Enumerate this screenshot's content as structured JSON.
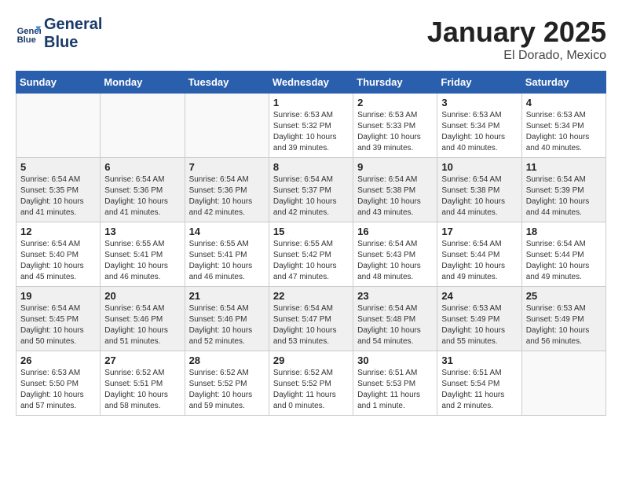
{
  "header": {
    "logo_line1": "General",
    "logo_line2": "Blue",
    "month": "January 2025",
    "location": "El Dorado, Mexico"
  },
  "days_of_week": [
    "Sunday",
    "Monday",
    "Tuesday",
    "Wednesday",
    "Thursday",
    "Friday",
    "Saturday"
  ],
  "weeks": [
    [
      {
        "num": "",
        "info": ""
      },
      {
        "num": "",
        "info": ""
      },
      {
        "num": "",
        "info": ""
      },
      {
        "num": "1",
        "info": "Sunrise: 6:53 AM\nSunset: 5:32 PM\nDaylight: 10 hours\nand 39 minutes."
      },
      {
        "num": "2",
        "info": "Sunrise: 6:53 AM\nSunset: 5:33 PM\nDaylight: 10 hours\nand 39 minutes."
      },
      {
        "num": "3",
        "info": "Sunrise: 6:53 AM\nSunset: 5:34 PM\nDaylight: 10 hours\nand 40 minutes."
      },
      {
        "num": "4",
        "info": "Sunrise: 6:53 AM\nSunset: 5:34 PM\nDaylight: 10 hours\nand 40 minutes."
      }
    ],
    [
      {
        "num": "5",
        "info": "Sunrise: 6:54 AM\nSunset: 5:35 PM\nDaylight: 10 hours\nand 41 minutes."
      },
      {
        "num": "6",
        "info": "Sunrise: 6:54 AM\nSunset: 5:36 PM\nDaylight: 10 hours\nand 41 minutes."
      },
      {
        "num": "7",
        "info": "Sunrise: 6:54 AM\nSunset: 5:36 PM\nDaylight: 10 hours\nand 42 minutes."
      },
      {
        "num": "8",
        "info": "Sunrise: 6:54 AM\nSunset: 5:37 PM\nDaylight: 10 hours\nand 42 minutes."
      },
      {
        "num": "9",
        "info": "Sunrise: 6:54 AM\nSunset: 5:38 PM\nDaylight: 10 hours\nand 43 minutes."
      },
      {
        "num": "10",
        "info": "Sunrise: 6:54 AM\nSunset: 5:38 PM\nDaylight: 10 hours\nand 44 minutes."
      },
      {
        "num": "11",
        "info": "Sunrise: 6:54 AM\nSunset: 5:39 PM\nDaylight: 10 hours\nand 44 minutes."
      }
    ],
    [
      {
        "num": "12",
        "info": "Sunrise: 6:54 AM\nSunset: 5:40 PM\nDaylight: 10 hours\nand 45 minutes."
      },
      {
        "num": "13",
        "info": "Sunrise: 6:55 AM\nSunset: 5:41 PM\nDaylight: 10 hours\nand 46 minutes."
      },
      {
        "num": "14",
        "info": "Sunrise: 6:55 AM\nSunset: 5:41 PM\nDaylight: 10 hours\nand 46 minutes."
      },
      {
        "num": "15",
        "info": "Sunrise: 6:55 AM\nSunset: 5:42 PM\nDaylight: 10 hours\nand 47 minutes."
      },
      {
        "num": "16",
        "info": "Sunrise: 6:54 AM\nSunset: 5:43 PM\nDaylight: 10 hours\nand 48 minutes."
      },
      {
        "num": "17",
        "info": "Sunrise: 6:54 AM\nSunset: 5:44 PM\nDaylight: 10 hours\nand 49 minutes."
      },
      {
        "num": "18",
        "info": "Sunrise: 6:54 AM\nSunset: 5:44 PM\nDaylight: 10 hours\nand 49 minutes."
      }
    ],
    [
      {
        "num": "19",
        "info": "Sunrise: 6:54 AM\nSunset: 5:45 PM\nDaylight: 10 hours\nand 50 minutes."
      },
      {
        "num": "20",
        "info": "Sunrise: 6:54 AM\nSunset: 5:46 PM\nDaylight: 10 hours\nand 51 minutes."
      },
      {
        "num": "21",
        "info": "Sunrise: 6:54 AM\nSunset: 5:46 PM\nDaylight: 10 hours\nand 52 minutes."
      },
      {
        "num": "22",
        "info": "Sunrise: 6:54 AM\nSunset: 5:47 PM\nDaylight: 10 hours\nand 53 minutes."
      },
      {
        "num": "23",
        "info": "Sunrise: 6:54 AM\nSunset: 5:48 PM\nDaylight: 10 hours\nand 54 minutes."
      },
      {
        "num": "24",
        "info": "Sunrise: 6:53 AM\nSunset: 5:49 PM\nDaylight: 10 hours\nand 55 minutes."
      },
      {
        "num": "25",
        "info": "Sunrise: 6:53 AM\nSunset: 5:49 PM\nDaylight: 10 hours\nand 56 minutes."
      }
    ],
    [
      {
        "num": "26",
        "info": "Sunrise: 6:53 AM\nSunset: 5:50 PM\nDaylight: 10 hours\nand 57 minutes."
      },
      {
        "num": "27",
        "info": "Sunrise: 6:52 AM\nSunset: 5:51 PM\nDaylight: 10 hours\nand 58 minutes."
      },
      {
        "num": "28",
        "info": "Sunrise: 6:52 AM\nSunset: 5:52 PM\nDaylight: 10 hours\nand 59 minutes."
      },
      {
        "num": "29",
        "info": "Sunrise: 6:52 AM\nSunset: 5:52 PM\nDaylight: 11 hours\nand 0 minutes."
      },
      {
        "num": "30",
        "info": "Sunrise: 6:51 AM\nSunset: 5:53 PM\nDaylight: 11 hours\nand 1 minute."
      },
      {
        "num": "31",
        "info": "Sunrise: 6:51 AM\nSunset: 5:54 PM\nDaylight: 11 hours\nand 2 minutes."
      },
      {
        "num": "",
        "info": ""
      }
    ]
  ]
}
